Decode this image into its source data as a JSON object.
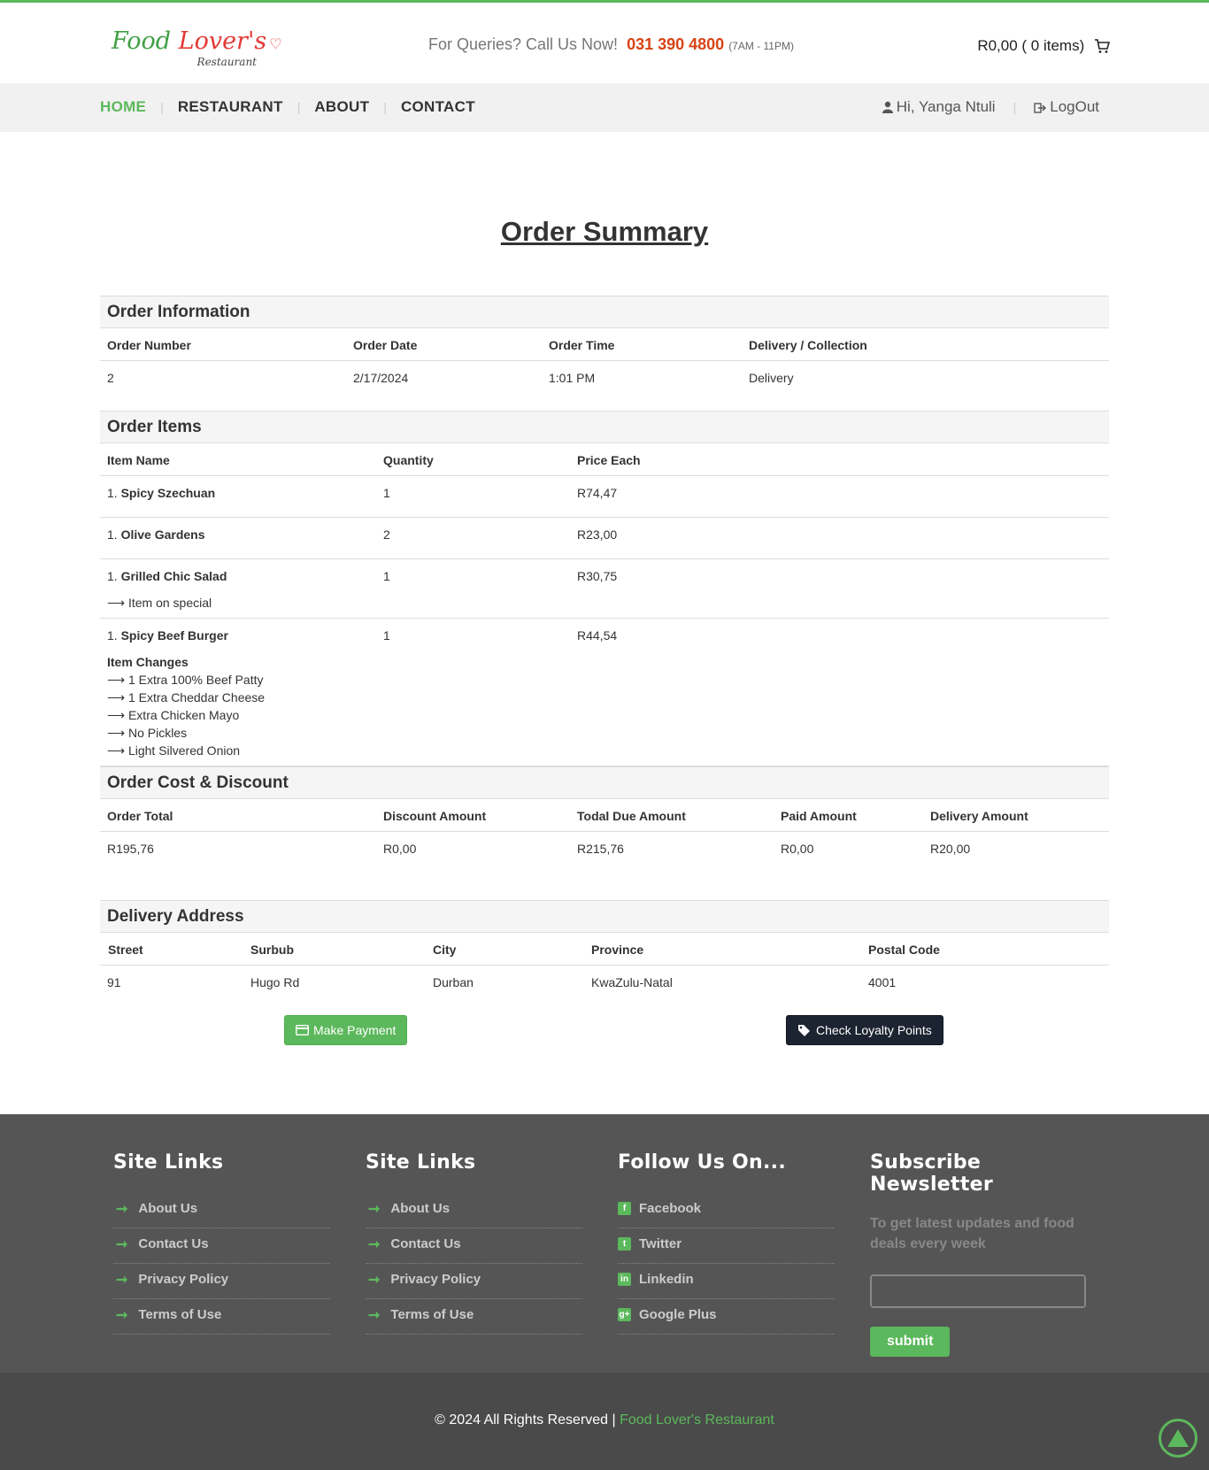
{
  "header": {
    "logo_main_1": "Food ",
    "logo_main_2": "Lover's",
    "logo_sub": "Restaurant",
    "query_label": "For Queries? Call Us Now!",
    "phone": "031 390 4800",
    "hours": "(7AM - 11PM)",
    "cart_text": "R0,00 ( 0 items)"
  },
  "nav": {
    "items": [
      "HOME",
      "RESTAURANT",
      "ABOUT",
      "CONTACT"
    ],
    "active": "HOME",
    "greeting": "Hi, Yanga Ntuli",
    "logout": "LogOut"
  },
  "page_title": "Order Summary",
  "order_info": {
    "title": "Order Information",
    "headers": [
      "Order Number",
      "Order Date",
      "Order Time",
      "Delivery / Collection"
    ],
    "values": [
      "2",
      "2/17/2024",
      "1:01 PM",
      "Delivery"
    ]
  },
  "order_items": {
    "title": "Order Items",
    "headers": [
      "Item Name",
      "Quantity",
      "Price Each"
    ],
    "items": [
      {
        "prefix": "1.",
        "name": "Spicy Szechuan",
        "qty": "1",
        "price": "R74,47"
      },
      {
        "prefix": "1.",
        "name": "Olive Gardens",
        "qty": "2",
        "price": "R23,00"
      },
      {
        "prefix": "1.",
        "name": "Grilled Chic Salad",
        "qty": "1",
        "price": "R30,75",
        "note": "⟶ Item on special"
      },
      {
        "prefix": "1.",
        "name": "Spicy Beef Burger",
        "qty": "1",
        "price": "R44,54",
        "changes_title": "Item Changes",
        "changes": [
          "⟶ 1 Extra 100% Beef Patty",
          "⟶ 1 Extra Cheddar Cheese",
          "⟶ Extra Chicken Mayo",
          "⟶ No Pickles",
          "⟶ Light Silvered Onion"
        ]
      }
    ]
  },
  "cost": {
    "title": "Order Cost & Discount",
    "headers": [
      "Order Total",
      "Discount Amount",
      "Todal Due Amount",
      "Paid Amount",
      "Delivery Amount"
    ],
    "values": [
      "R195,76",
      "R0,00",
      "R215,76",
      "R0,00",
      "R20,00"
    ]
  },
  "address": {
    "title": "Delivery Address",
    "headers": [
      "Street",
      "Surbub",
      "City",
      "Province",
      "Postal Code"
    ],
    "values": [
      "91",
      "Hugo Rd",
      "Durban",
      "KwaZulu-Natal",
      "4001"
    ]
  },
  "buttons": {
    "pay": "Make Payment",
    "loyalty": "Check Loyalty Points"
  },
  "footer": {
    "col1": {
      "title": "Site Links",
      "links": [
        "About Us",
        "Contact Us",
        "Privacy Policy",
        "Terms of Use"
      ]
    },
    "col2": {
      "title": "Site Links",
      "links": [
        "About Us",
        "Contact Us",
        "Privacy Policy",
        "Terms of Use"
      ]
    },
    "col3": {
      "title": "Follow Us On...",
      "links": [
        "Facebook",
        "Twitter",
        "Linkedin",
        "Google Plus"
      ],
      "icons": [
        "facebook-icon",
        "twitter-icon",
        "linkedin-icon",
        "google-plus-icon"
      ]
    },
    "newsletter": {
      "title": "Subscribe Newsletter",
      "text": "To get latest updates and food deals every week",
      "input_value": "",
      "submit": "submit"
    }
  },
  "copyright": {
    "text": "© 2024 All Rights Reserved | ",
    "brand": "Food Lover's Restaurant"
  },
  "colors": {
    "accent": "#5cb85c",
    "phone": "#d84315",
    "dark_button": "#1c2331",
    "footer": "#555555"
  }
}
